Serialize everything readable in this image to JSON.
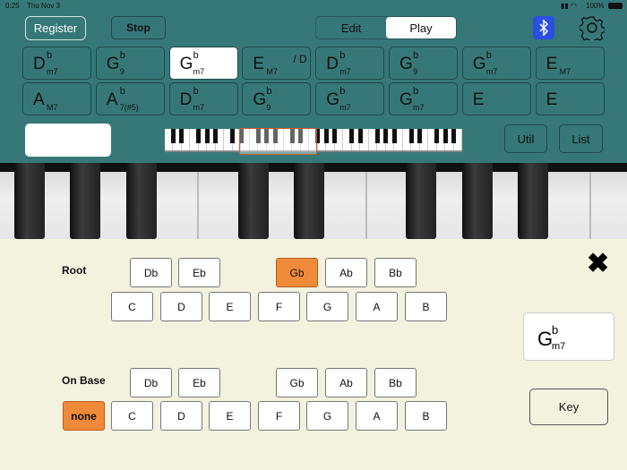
{
  "status": {
    "time": "0:25",
    "date": "Thu Nov 3",
    "battery": "100%"
  },
  "toolbar": {
    "register": "Register",
    "stop": "Stop",
    "mode": [
      "Edit",
      "Play"
    ],
    "selected_mode": "Play",
    "util": "Util",
    "list": "List"
  },
  "chords": [
    {
      "root": "D",
      "acc": "b",
      "qual": "m7",
      "bass": ""
    },
    {
      "root": "G",
      "acc": "b",
      "qual": "9",
      "bass": ""
    },
    {
      "root": "G",
      "acc": "b",
      "qual": "m7",
      "bass": "",
      "selected": true
    },
    {
      "root": "E",
      "acc": "",
      "qual": "M7",
      "bass": "/ D"
    },
    {
      "root": "D",
      "acc": "b",
      "qual": "m7",
      "bass": ""
    },
    {
      "root": "G",
      "acc": "b",
      "qual": "9",
      "bass": ""
    },
    {
      "root": "G",
      "acc": "b",
      "qual": "m7",
      "bass": ""
    },
    {
      "root": "E",
      "acc": "",
      "qual": "M7",
      "bass": ""
    },
    {
      "root": "A",
      "acc": "",
      "qual": "M7",
      "bass": ""
    },
    {
      "root": "A",
      "acc": "b",
      "qual": "7(#5)",
      "bass": ""
    },
    {
      "root": "D",
      "acc": "b",
      "qual": "m7",
      "bass": ""
    },
    {
      "root": "G",
      "acc": "b",
      "qual": "9",
      "bass": ""
    },
    {
      "root": "G",
      "acc": "b",
      "qual": "m7",
      "bass": ""
    },
    {
      "root": "G",
      "acc": "b",
      "qual": "m7",
      "bass": ""
    },
    {
      "root": "E",
      "acc": "",
      "qual": "",
      "bass": ""
    },
    {
      "root": "E",
      "acc": "",
      "qual": "",
      "bass": ""
    }
  ],
  "editor": {
    "root_label": "Root",
    "onbase_label": "On Base",
    "flats": [
      "Db",
      "Eb",
      "Gb",
      "Ab",
      "Bb"
    ],
    "naturals": [
      "C",
      "D",
      "E",
      "F",
      "G",
      "A",
      "B"
    ],
    "root_selected": "Gb",
    "onbase_selected": "none",
    "none_label": "none",
    "current": {
      "root": "G",
      "acc": "b",
      "qual": "m7"
    },
    "key_label": "Key"
  },
  "colors": {
    "teal": "#367878",
    "accent": "#ef8a3a",
    "bluetooth": "#2b4fe0"
  }
}
